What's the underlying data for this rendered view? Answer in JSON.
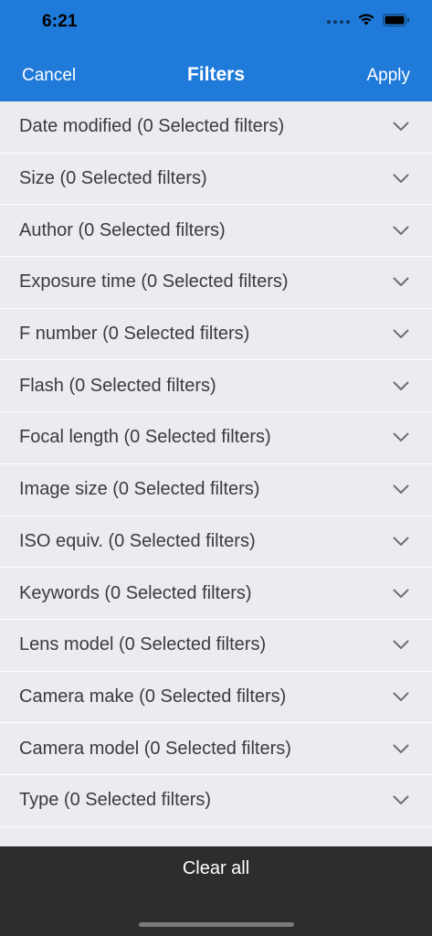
{
  "status_bar": {
    "time": "6:21"
  },
  "nav": {
    "cancel_label": "Cancel",
    "title": "Filters",
    "apply_label": "Apply"
  },
  "filters": [
    {
      "label": "Date modified (0 Selected filters)"
    },
    {
      "label": "Size (0 Selected filters)"
    },
    {
      "label": "Author (0 Selected filters)"
    },
    {
      "label": "Exposure time (0 Selected filters)"
    },
    {
      "label": "F number (0 Selected filters)"
    },
    {
      "label": "Flash (0 Selected filters)"
    },
    {
      "label": "Focal length (0 Selected filters)"
    },
    {
      "label": "Image size (0 Selected filters)"
    },
    {
      "label": "ISO equiv. (0 Selected filters)"
    },
    {
      "label": "Keywords (0 Selected filters)"
    },
    {
      "label": "Lens model (0 Selected filters)"
    },
    {
      "label": "Camera make (0 Selected filters)"
    },
    {
      "label": "Camera model (0 Selected filters)"
    },
    {
      "label": "Type (0 Selected filters)"
    }
  ],
  "bottom": {
    "clear_all_label": "Clear all"
  },
  "icons": {
    "row_icon": "chevron-down-icon",
    "wifi": "wifi-icon",
    "battery": "battery-icon",
    "signal": "cellular-signal-icon"
  },
  "colors": {
    "header_bg": "#1f7ad9",
    "row_bg": "#ebebf0",
    "bottom_bg": "#2d2d2d",
    "chevron": "#6e6e73"
  }
}
